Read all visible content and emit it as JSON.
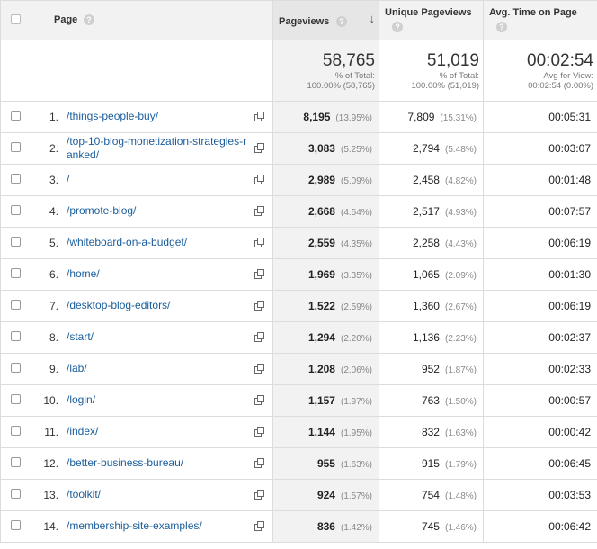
{
  "header": {
    "page": "Page",
    "pageviews": "Pageviews",
    "unique_pageviews": "Unique Pageviews",
    "avg_time": "Avg. Time on Page",
    "help_glyph": "?",
    "sort_glyph": "↓"
  },
  "totals": {
    "pageviews": "58,765",
    "pageviews_sub1": "% of Total:",
    "pageviews_sub2": "100.00% (58,765)",
    "unique": "51,019",
    "unique_sub1": "% of Total:",
    "unique_sub2": "100.00% (51,019)",
    "avg": "00:02:54",
    "avg_sub1": "Avg for View:",
    "avg_sub2": "00:02:54 (0.00%)"
  },
  "rows": [
    {
      "idx": "1.",
      "page": "/things-people-buy/",
      "pv": "8,195",
      "pv_pct": "(13.95%)",
      "up": "7,809",
      "up_pct": "(15.31%)",
      "avg": "00:05:31"
    },
    {
      "idx": "2.",
      "page": "/top-10-blog-monetization-strategies-ranked/",
      "pv": "3,083",
      "pv_pct": "(5.25%)",
      "up": "2,794",
      "up_pct": "(5.48%)",
      "avg": "00:03:07"
    },
    {
      "idx": "3.",
      "page": "/",
      "pv": "2,989",
      "pv_pct": "(5.09%)",
      "up": "2,458",
      "up_pct": "(4.82%)",
      "avg": "00:01:48"
    },
    {
      "idx": "4.",
      "page": "/promote-blog/",
      "pv": "2,668",
      "pv_pct": "(4.54%)",
      "up": "2,517",
      "up_pct": "(4.93%)",
      "avg": "00:07:57"
    },
    {
      "idx": "5.",
      "page": "/whiteboard-on-a-budget/",
      "pv": "2,559",
      "pv_pct": "(4.35%)",
      "up": "2,258",
      "up_pct": "(4.43%)",
      "avg": "00:06:19"
    },
    {
      "idx": "6.",
      "page": "/home/",
      "pv": "1,969",
      "pv_pct": "(3.35%)",
      "up": "1,065",
      "up_pct": "(2.09%)",
      "avg": "00:01:30"
    },
    {
      "idx": "7.",
      "page": "/desktop-blog-editors/",
      "pv": "1,522",
      "pv_pct": "(2.59%)",
      "up": "1,360",
      "up_pct": "(2.67%)",
      "avg": "00:06:19"
    },
    {
      "idx": "8.",
      "page": "/start/",
      "pv": "1,294",
      "pv_pct": "(2.20%)",
      "up": "1,136",
      "up_pct": "(2.23%)",
      "avg": "00:02:37"
    },
    {
      "idx": "9.",
      "page": "/lab/",
      "pv": "1,208",
      "pv_pct": "(2.06%)",
      "up": "952",
      "up_pct": "(1.87%)",
      "avg": "00:02:33"
    },
    {
      "idx": "10.",
      "page": "/login/",
      "pv": "1,157",
      "pv_pct": "(1.97%)",
      "up": "763",
      "up_pct": "(1.50%)",
      "avg": "00:00:57"
    },
    {
      "idx": "11.",
      "page": "/index/",
      "pv": "1,144",
      "pv_pct": "(1.95%)",
      "up": "832",
      "up_pct": "(1.63%)",
      "avg": "00:00:42"
    },
    {
      "idx": "12.",
      "page": "/better-business-bureau/",
      "pv": "955",
      "pv_pct": "(1.63%)",
      "up": "915",
      "up_pct": "(1.79%)",
      "avg": "00:06:45"
    },
    {
      "idx": "13.",
      "page": "/toolkit/",
      "pv": "924",
      "pv_pct": "(1.57%)",
      "up": "754",
      "up_pct": "(1.48%)",
      "avg": "00:03:53"
    },
    {
      "idx": "14.",
      "page": "/membership-site-examples/",
      "pv": "836",
      "pv_pct": "(1.42%)",
      "up": "745",
      "up_pct": "(1.46%)",
      "avg": "00:06:42"
    }
  ]
}
